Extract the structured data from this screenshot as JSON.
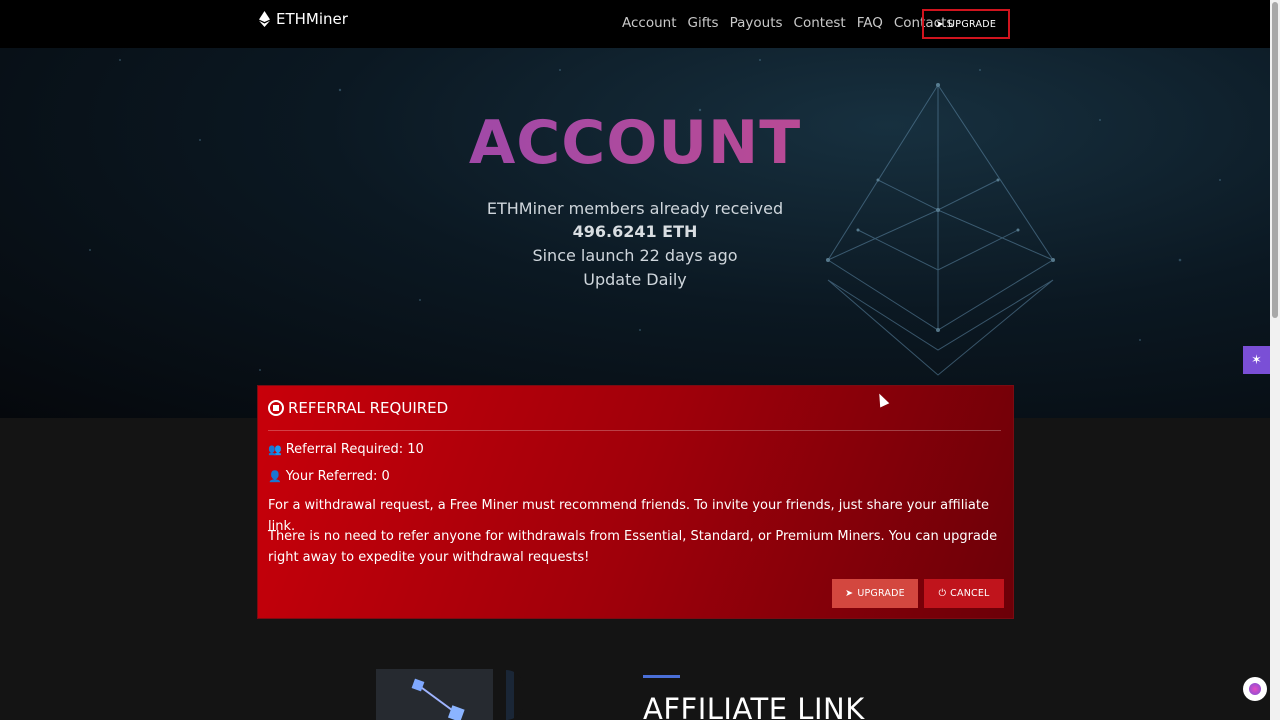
{
  "navbar": {
    "brand": "ETHMiner",
    "links": [
      "Account",
      "Gifts",
      "Payouts",
      "Contest",
      "FAQ",
      "Contacts"
    ],
    "upgrade_label": "UPGRADE"
  },
  "hero": {
    "title": "ACCOUNT",
    "line1": "ETHMiner members already received",
    "amount": "496.6241 ETH",
    "line3": "Since launch 22 days ago",
    "line4": "Update Daily"
  },
  "modal": {
    "title": "REFERRAL REQUIRED",
    "referral_required": "Referral Required: 10",
    "your_referred": "Your Referred: 0",
    "paragraph1": "For a withdrawal request, a Free Miner must recommend friends. To invite your friends, just share your affiliate link.",
    "paragraph2": "There is no need to refer anyone for withdrawals from Essential, Standard, or Premium Miners. You can upgrade right away to expedite your withdrawal requests!",
    "upgrade_label": "UPGRADE",
    "cancel_label": "CANCEL"
  },
  "section": {
    "title": "AFFILIATE LINK"
  },
  "colors": {
    "modal_red": "#c8000a",
    "nav_border": "#d0141e",
    "title_gradient_start": "#7c47c4",
    "title_gradient_end": "#d24a7d",
    "accent_blue": "#4a6fd8"
  },
  "icons": [
    "ethereum-icon",
    "rocket-icon",
    "stop-circle-icon",
    "users-icon",
    "user-check-icon",
    "power-icon",
    "sparkle-icon"
  ]
}
